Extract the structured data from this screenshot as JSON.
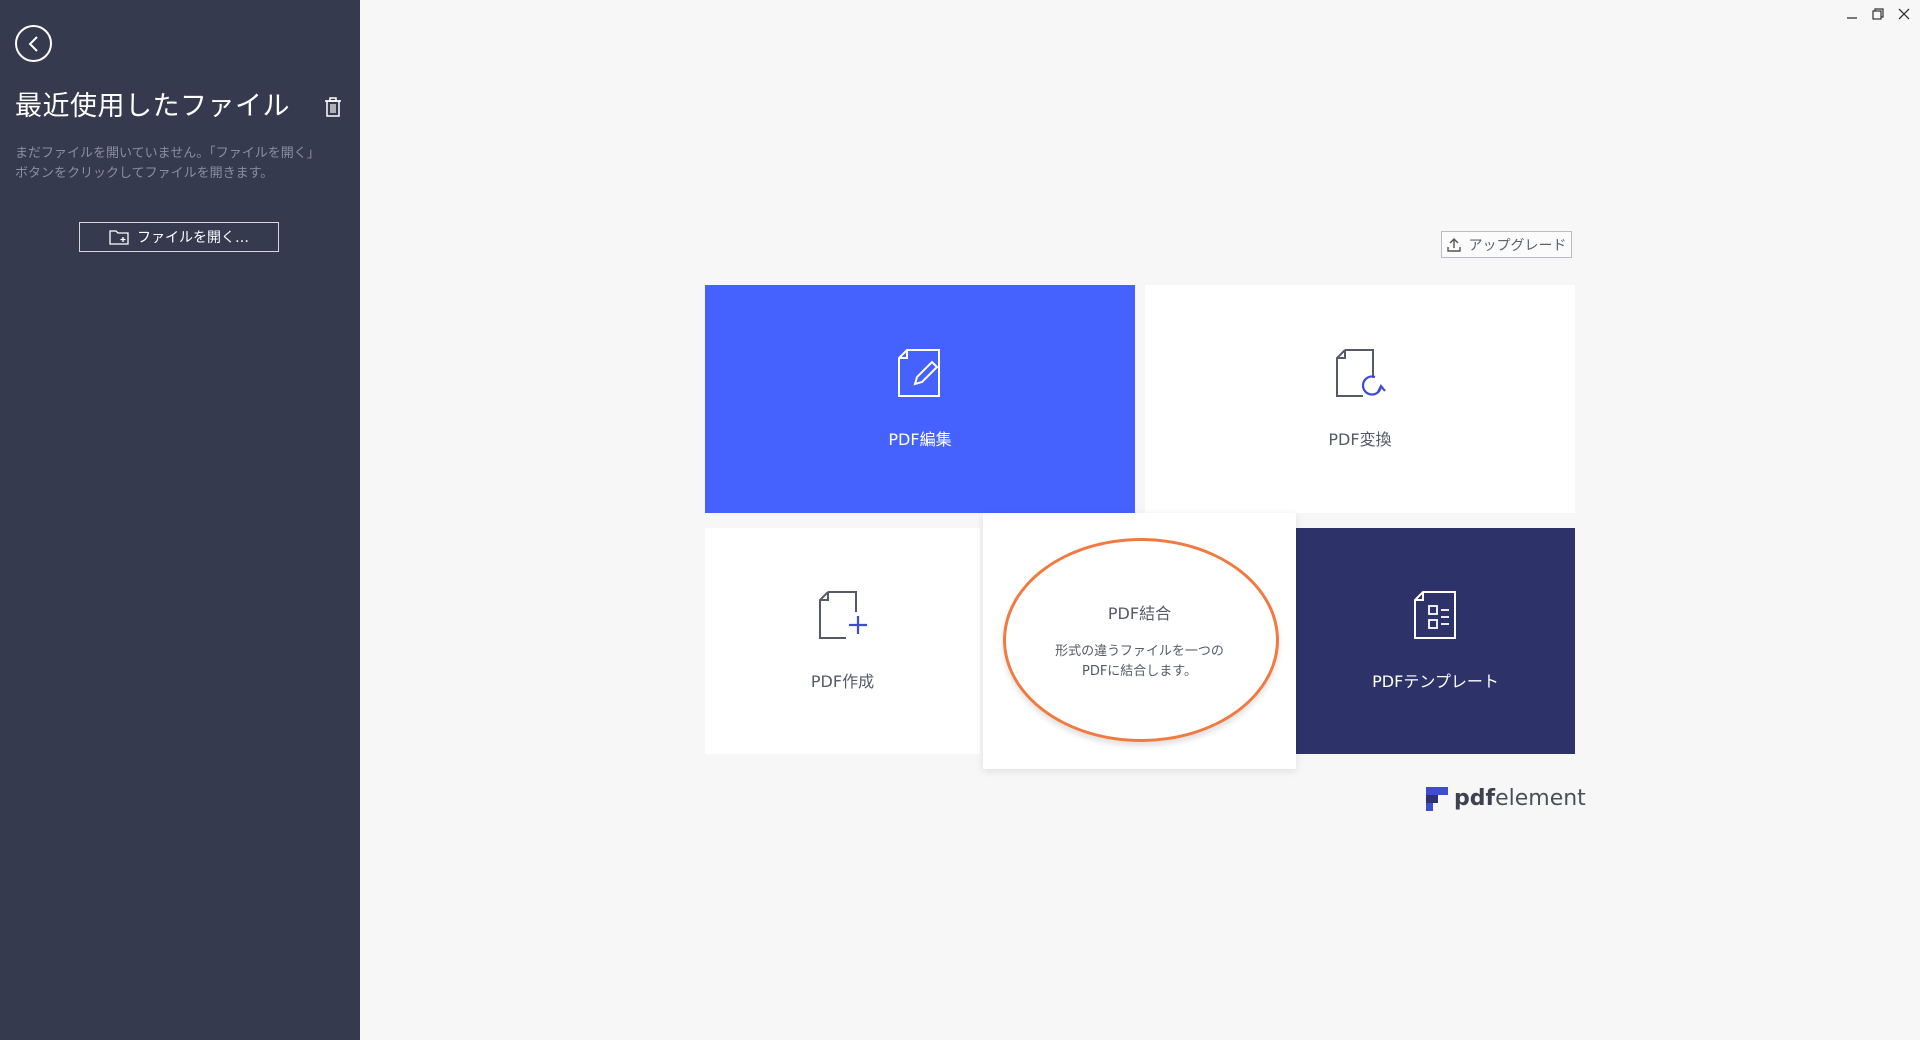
{
  "sidebar": {
    "title": "最近使用したファイル",
    "hint": "まだファイルを開いていません。「ファイルを開く」ボタンをクリックしてファイルを開きます。",
    "open_button_label": "ファイルを開く…"
  },
  "upgrade_label": "アップグレード",
  "tiles": {
    "edit": {
      "label": "PDF編集"
    },
    "convert": {
      "label": "PDF変換"
    },
    "create": {
      "label": "PDF作成"
    },
    "combine": {
      "label": "PDF結合",
      "desc_line1": "形式の違うファイルを一つの",
      "desc_line2": "PDFに結合します。"
    },
    "template": {
      "label": "PDFテンプレート"
    }
  },
  "brand": {
    "bold": "pdf",
    "regular": "element"
  },
  "colors": {
    "sidebar_bg": "#363a4f",
    "edit_tile": "#4562ff",
    "template_tile": "#2d3269",
    "highlight_circle": "#f07a3f",
    "icon_blue": "#3f4bd1"
  }
}
